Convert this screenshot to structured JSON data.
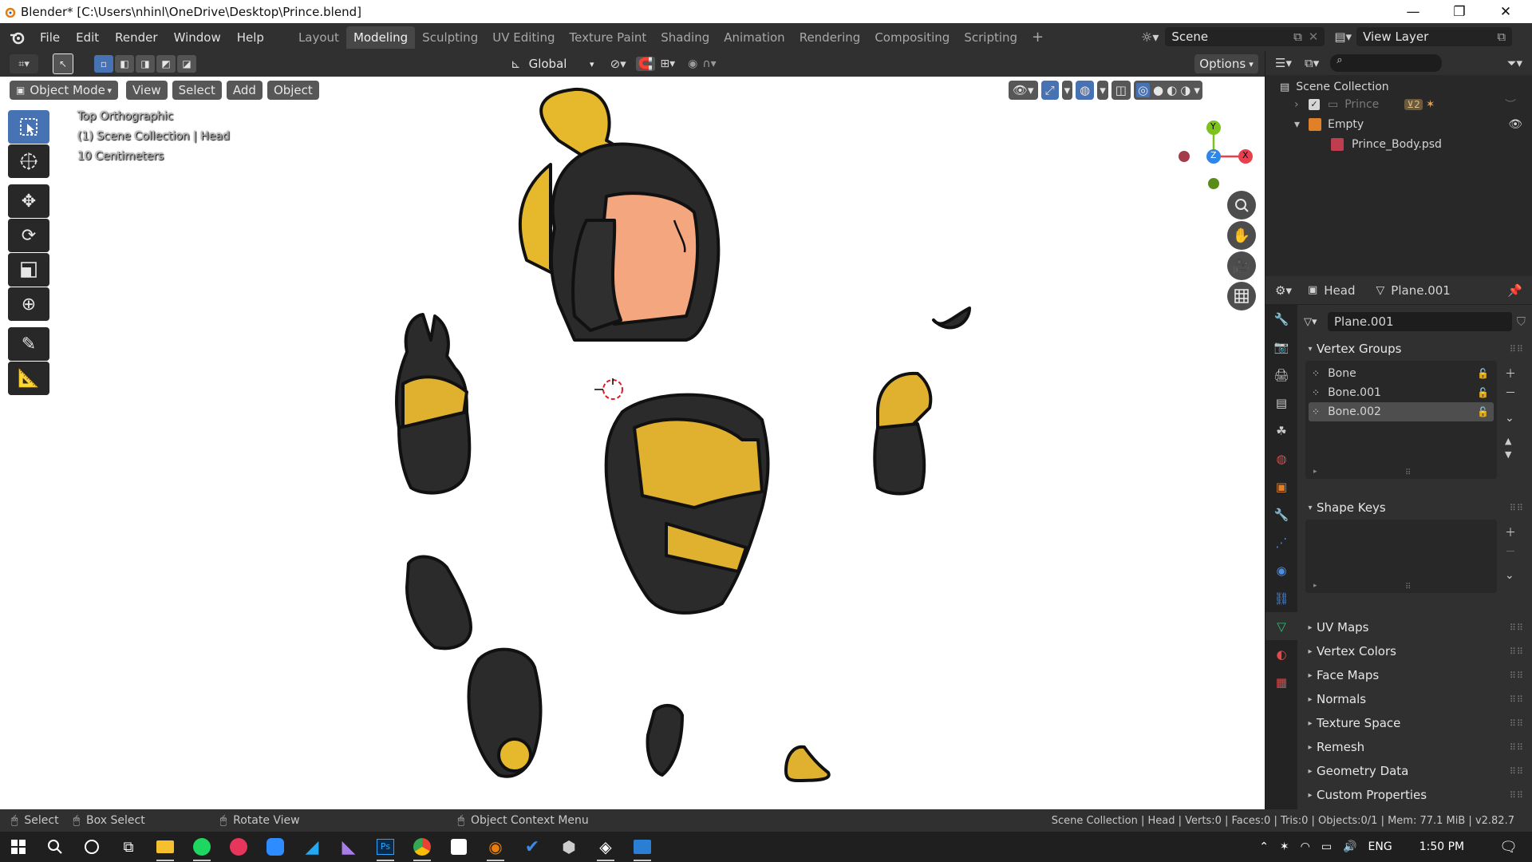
{
  "window": {
    "title": "Blender* [C:\\Users\\nhinl\\OneDrive\\Desktop\\Prince.blend]",
    "minimize": "—",
    "maximize": "❐",
    "close": "✕"
  },
  "menu": [
    "File",
    "Edit",
    "Render",
    "Window",
    "Help"
  ],
  "workspaces": [
    "Layout",
    "Modeling",
    "Sculpting",
    "UV Editing",
    "Texture Paint",
    "Shading",
    "Animation",
    "Rendering",
    "Compositing",
    "Scripting"
  ],
  "active_workspace": "Modeling",
  "scene": {
    "name": "Scene",
    "view_layer": "View Layer"
  },
  "tool_header": {
    "transform_orientation": "Global",
    "options": "Options"
  },
  "viewport": {
    "mode": "Object Mode",
    "menus": [
      "View",
      "Select",
      "Add",
      "Object"
    ],
    "info_view": "Top Orthographic",
    "info_collection": "(1) Scene Collection | Head",
    "info_scale": "10 Centimeters",
    "gizmo": {
      "y": "Y",
      "z": "Z",
      "x": "X"
    }
  },
  "outliner": {
    "scene_collection": "Scene Collection",
    "items": [
      {
        "name": "Prince",
        "badge": "2"
      },
      {
        "name": "Empty"
      },
      {
        "name": "Prince_Body.psd"
      }
    ]
  },
  "properties": {
    "object": "Head",
    "data": "Plane.001",
    "mesh_name": "Plane.001",
    "panels": {
      "vertex_groups": "Vertex Groups",
      "shape_keys": "Shape Keys"
    },
    "vertex_groups": [
      "Bone",
      "Bone.001",
      "Bone.002"
    ],
    "selected_vertex_group": "Bone.002",
    "collapsed_panels": [
      "UV Maps",
      "Vertex Colors",
      "Face Maps",
      "Normals",
      "Texture Space",
      "Remesh",
      "Geometry Data",
      "Custom Properties"
    ]
  },
  "statusbar": {
    "select": "Select",
    "box_select": "Box Select",
    "rotate_view": "Rotate View",
    "context_menu": "Object Context Menu",
    "stats": "Scene Collection | Head | Verts:0 | Faces:0 | Tris:0 | Objects:0/1 | Mem: 77.1 MiB | v2.82.7"
  },
  "taskbar": {
    "language": "ENG",
    "time": "1:50 PM"
  },
  "colors": {
    "accent": "#4772b3",
    "gold": "#e0b12e",
    "armor": "#2b2b2b",
    "skin": "#f4a67e",
    "x_axis": "#e8414e",
    "y_axis": "#7ec21d",
    "z_axis": "#2e87e8"
  }
}
